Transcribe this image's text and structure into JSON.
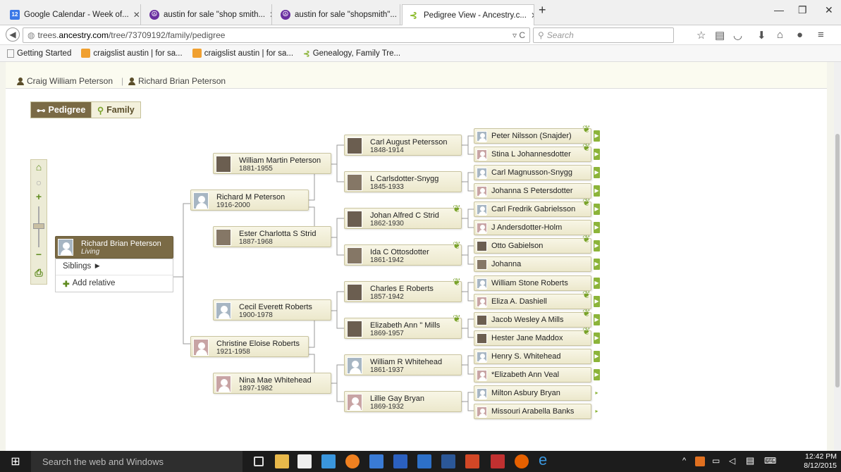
{
  "browser": {
    "tabs": [
      {
        "label": "Google Calendar - Week of...",
        "icon": "calendar-icon"
      },
      {
        "label": "austin for sale \"shop smith...",
        "icon": "peace-icon"
      },
      {
        "label": "austin for sale \"shopsmith\"...",
        "icon": "peace-icon"
      },
      {
        "label": "Pedigree View - Ancestry.c...",
        "icon": "ancestry-leaf-icon"
      }
    ],
    "url_prefix": "trees.",
    "url_domain": "ancestry.com",
    "url_path": "/tree/73709192/family/pedigree",
    "search_placeholder": "Search",
    "bookmarks": [
      {
        "label": "Getting Started"
      },
      {
        "label": "craigslist austin | for sa..."
      },
      {
        "label": "craigslist austin | for sa..."
      },
      {
        "label": "Genealogy, Family Tre..."
      }
    ]
  },
  "page": {
    "breadcrumb": [
      "Craig William Peterson",
      "Richard Brian Peterson"
    ],
    "breadcrumb_sep": "|",
    "view_buttons": {
      "pedigree": "Pedigree",
      "family": "Family"
    }
  },
  "tree": {
    "root": {
      "name": "Richard Brian Peterson",
      "dates": "Living"
    },
    "root_menu": {
      "siblings": "Siblings ►",
      "add_relative": "Add relative"
    },
    "gen2": [
      {
        "name": "Richard M Peterson",
        "dates": "1916-2000"
      },
      {
        "name": "Christine Eloise Roberts",
        "dates": "1921-1958"
      }
    ],
    "gen3": [
      {
        "name": "William Martin Peterson",
        "dates": "1881-1955"
      },
      {
        "name": "Ester Charlotta S Strid",
        "dates": "1887-1968"
      },
      {
        "name": "Cecil Everett Roberts",
        "dates": "1900-1978"
      },
      {
        "name": "Nina Mae Whitehead",
        "dates": "1897-1982"
      }
    ],
    "gen4": [
      {
        "name": "Carl August Petersson",
        "dates": "1848-1914"
      },
      {
        "name": "L Carlsdotter-Snygg",
        "dates": "1845-1933"
      },
      {
        "name": "Johan Alfred C Strid",
        "dates": "1862-1930"
      },
      {
        "name": "Ida C Ottosdotter",
        "dates": "1861-1942"
      },
      {
        "name": "Charles E Roberts",
        "dates": "1857-1942"
      },
      {
        "name": "Elizabeth Ann \" Mills",
        "dates": "1869-1957"
      },
      {
        "name": "William R Whitehead",
        "dates": "1861-1937"
      },
      {
        "name": "Lillie Gay Bryan",
        "dates": "1869-1932"
      }
    ],
    "gen5": [
      {
        "name": "Peter Nilsson (Snajder)"
      },
      {
        "name": "Stina L Johannesdotter"
      },
      {
        "name": "Carl Magnusson-Snygg"
      },
      {
        "name": "Johanna S Petersdotter"
      },
      {
        "name": "Carl Fredrik Gabrielsson"
      },
      {
        "name": "J Andersdotter-Holm"
      },
      {
        "name": "Otto Gabielson"
      },
      {
        "name": "Johanna"
      },
      {
        "name": "William Stone Roberts"
      },
      {
        "name": "Eliza A. Dashiell"
      },
      {
        "name": "Jacob Wesley A Mills"
      },
      {
        "name": "Hester Jane Maddox"
      },
      {
        "name": "Henry S. Whitehead"
      },
      {
        "name": "*Elizabeth Ann Veal"
      },
      {
        "name": "Milton Asbury Bryan"
      },
      {
        "name": "Missouri Arabella Banks"
      }
    ]
  },
  "taskbar": {
    "search_placeholder": "Search the web and Windows",
    "time": "12:42 PM",
    "date": "8/12/2015"
  },
  "colors": {
    "accent_green": "#8cb43a",
    "brown": "#7a6a45",
    "card_bg": "#f3f0dc"
  }
}
